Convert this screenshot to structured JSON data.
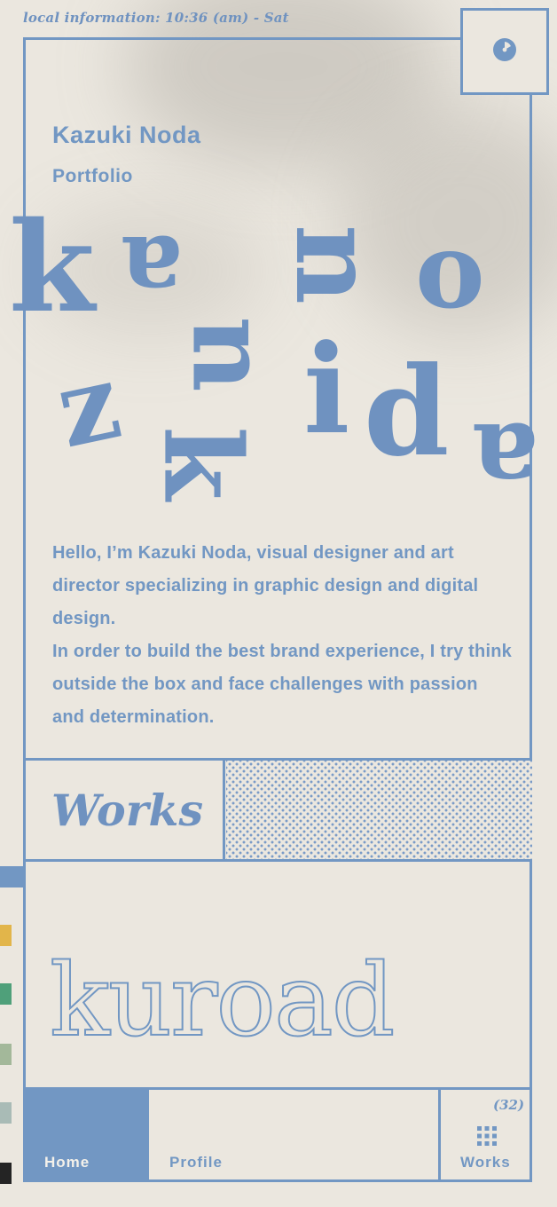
{
  "header": {
    "local_info": "local information: 10:36 (am) - Sat",
    "clock_icon": "clock-icon"
  },
  "profile": {
    "name": "Kazuki Noda",
    "subtitle": "Portfolio"
  },
  "hero_letters": [
    "k",
    "a",
    "z",
    "u",
    "k",
    "i",
    "n",
    "o",
    "d",
    "a"
  ],
  "intro": {
    "line1": "Hello, I’m Kazuki Noda, visual designer and art director specializing in graphic design and digital design.",
    "line2": "In order to build the best brand experience, I try think outside the box and face challenges with passion and determination."
  },
  "works_section": {
    "title": "Works",
    "featured": "kuroad"
  },
  "nav": {
    "home": "Home",
    "profile": "Profile",
    "works": "Works",
    "works_count": "(32)",
    "grid_icon": "grid-icon"
  },
  "colors": {
    "accent": "#7297c3",
    "background": "#ebe7df",
    "side_marks": [
      "#7297c3",
      "#e2b54a",
      "#4fa07a",
      "#a3b89a",
      "#a9bbb6",
      "#242424"
    ]
  }
}
